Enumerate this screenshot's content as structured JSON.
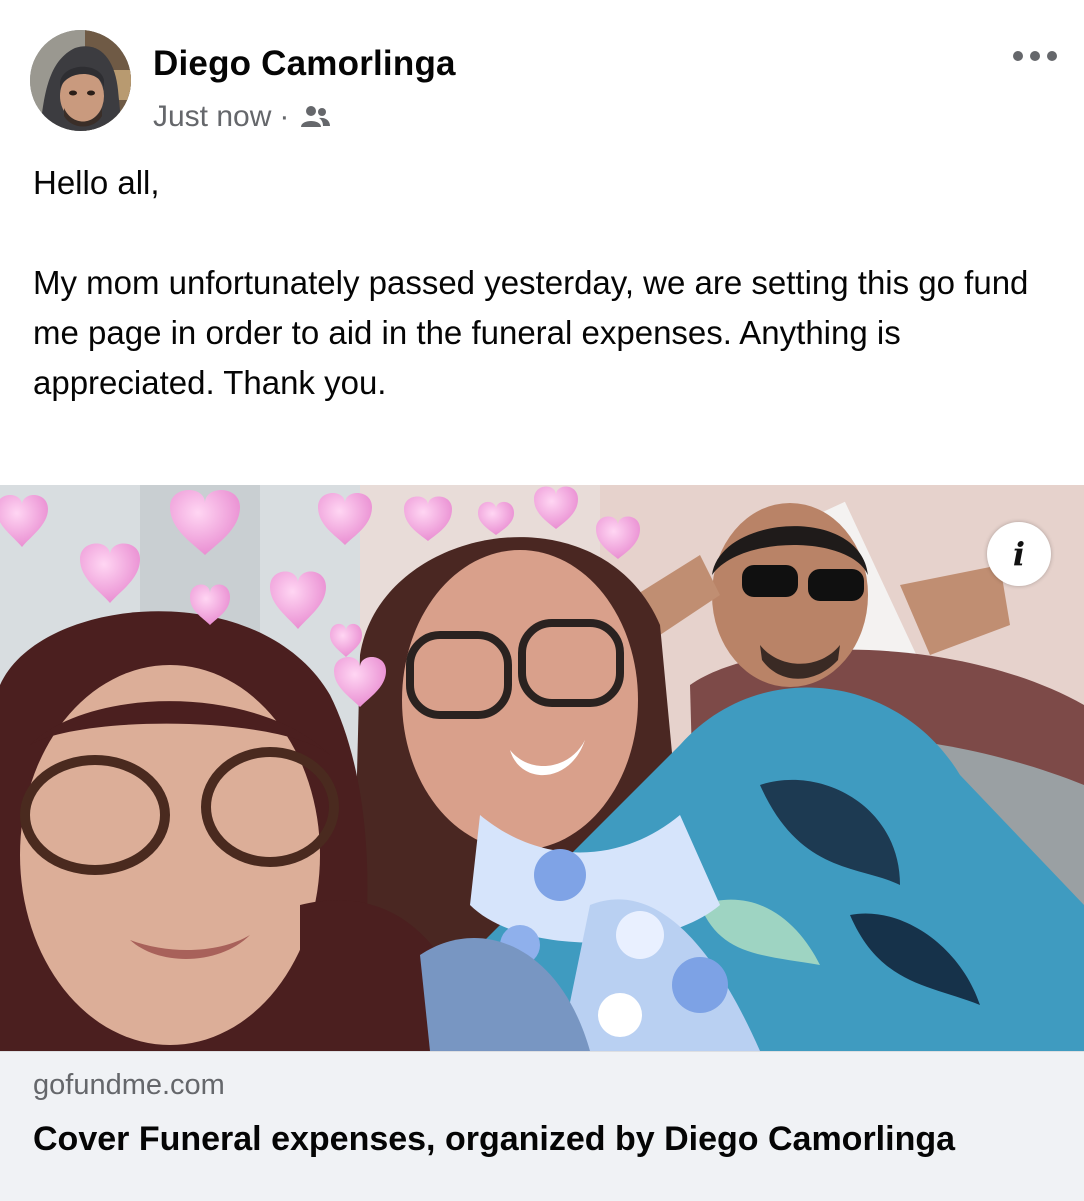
{
  "post": {
    "author": {
      "name": "Diego Camorlinga",
      "avatar_icon": "profile-photo"
    },
    "timestamp": "Just now",
    "separator": "·",
    "audience_icon": "friends-icon",
    "more_icon": "more-horizontal-icon",
    "text": {
      "greeting": "Hello all,",
      "body": "My mom unfortunately passed yesterday, we are setting this go fund me page in order to aid in the funeral expenses. Anything is appreciated. Thank you."
    },
    "link_preview": {
      "image_icon": "group-selfie-photo",
      "info_label": "i",
      "domain": "gofundme.com",
      "title": "Cover Funeral expenses, organized by Diego Camorlinga"
    }
  },
  "colors": {
    "text_primary": "#050505",
    "text_secondary": "#65676b",
    "link_meta_background": "#f0f2f5"
  }
}
